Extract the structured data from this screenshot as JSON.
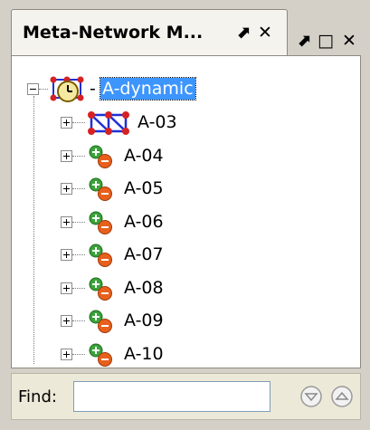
{
  "panel": {
    "tab_title": "Meta-Network M...",
    "tab_pin": "⬈",
    "tab_close": "✕",
    "right_controls": {
      "pin": "⬈",
      "maximize": "□",
      "close": "✕"
    }
  },
  "tree": {
    "root": {
      "label": "A-dynamic",
      "dash": "-"
    },
    "children": [
      {
        "label": "A-03"
      },
      {
        "label": "A-04"
      },
      {
        "label": "A-05"
      },
      {
        "label": "A-06"
      },
      {
        "label": "A-07"
      },
      {
        "label": "A-08"
      },
      {
        "label": "A-09"
      },
      {
        "label": "A-10"
      }
    ]
  },
  "find": {
    "label": "Find:",
    "value": "",
    "placeholder": ""
  },
  "colors": {
    "selection": "#3d95ff",
    "node_green": "#3aa33a",
    "node_orange": "#e8601c",
    "network_blue": "#1f2fd6",
    "network_red": "#d62222"
  }
}
